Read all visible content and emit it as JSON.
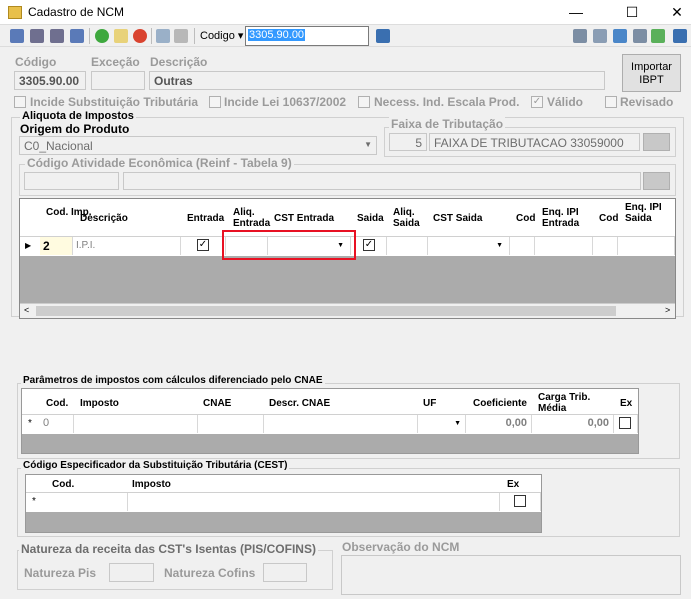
{
  "window": {
    "title": "Cadastro de NCM",
    "minimize": "—",
    "maximize": "☐",
    "close": "✕"
  },
  "toolbar": {
    "codigo_label": "Codigo",
    "codigo_value": "3305.90.00"
  },
  "header": {
    "codigo_label": "Código",
    "codigo_value": "3305.90.00",
    "excecao_label": "Exceção",
    "excecao_value": "",
    "descricao_label": "Descrição",
    "descricao_value": "Outras",
    "importar_button": "Importar IBPT"
  },
  "flags": {
    "incide_st": "Incide Substituição Tributária",
    "incide_lei": "Incide Lei 10637/2002",
    "necess": "Necess. Ind. Escala Prod.",
    "valido": "Válido",
    "revisado": "Revisado"
  },
  "aliquota": {
    "group_title": "Aliquota de Impostos",
    "origem_label": "Origem do Produto",
    "origem_value": "C0_Nacional",
    "faixa_label": "Faixa de Tributação",
    "faixa_num": "5",
    "faixa_desc": "FAIXA DE TRIBUTACAO 33059000",
    "cae_label": "Código Atividade Econômica (Reinf - Tabela 9)"
  },
  "impostos_grid": {
    "headers": [
      "Cod. Imp.",
      "Descrição",
      "Entrada",
      "Aliq. Entrada",
      "CST Entrada",
      "Saida",
      "Aliq. Saida",
      "CST Saida",
      "Cod",
      "Enq. IPI Entrada",
      "Cod",
      "Enq. IPI Saida"
    ],
    "row": {
      "cod": "2",
      "descricao": "I.P.I.",
      "entrada": true,
      "saida": true
    }
  },
  "cnae": {
    "title": "Parâmetros de impostos com cálculos diferenciado pelo CNAE",
    "headers": [
      "Cod.",
      "Imposto",
      "CNAE",
      "Descr. CNAE",
      "UF",
      "Coeficiente",
      "Carga Trib. Média",
      "Ex"
    ],
    "row": {
      "cod": "0",
      "coeficiente": "0,00",
      "carga": "0,00"
    }
  },
  "cest": {
    "title": "Código Especificador da Substituição Tributária (CEST)",
    "headers": [
      "Cod.",
      "Imposto",
      "Ex"
    ]
  },
  "natureza": {
    "title": "Natureza da receita das CST's Isentas (PIS/COFINS)",
    "pis_label": "Natureza Pis",
    "cofins_label": "Natureza Cofins"
  },
  "observacao": {
    "label": "Observação do NCM"
  },
  "colors": {
    "highlight": "#e81123",
    "selection": "#3399ff"
  }
}
